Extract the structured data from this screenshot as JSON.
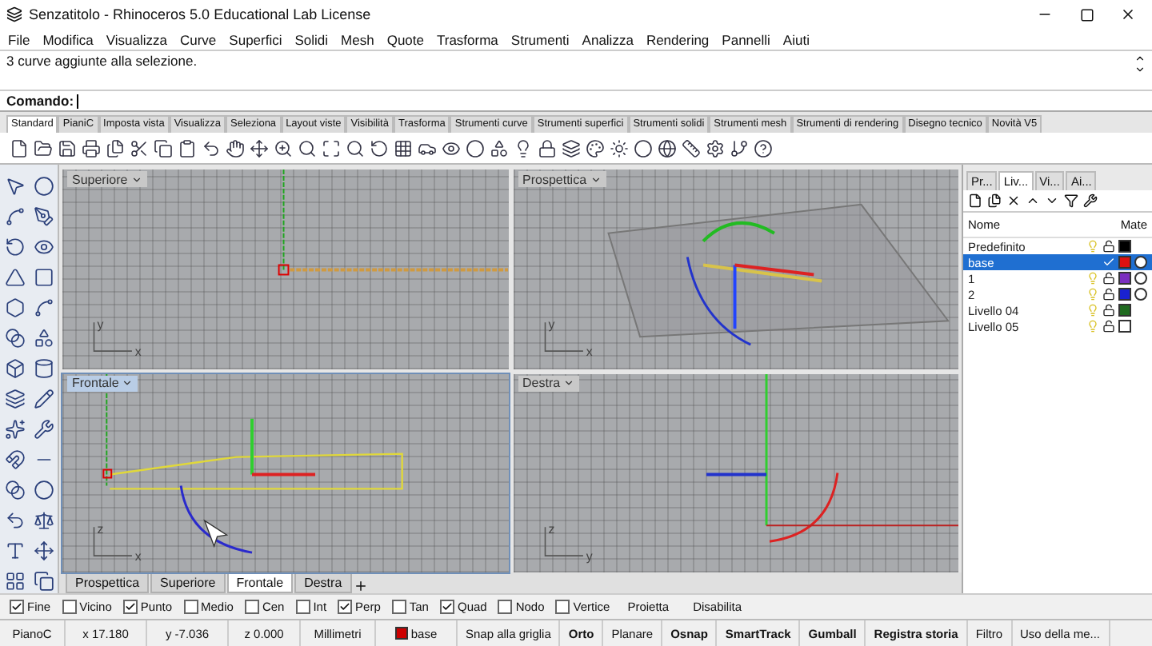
{
  "window": {
    "title": "Senzatitolo - Rhinoceros 5.0 Educational Lab License"
  },
  "menu": [
    "File",
    "Modifica",
    "Visualizza",
    "Curve",
    "Superfici",
    "Solidi",
    "Mesh",
    "Quote",
    "Trasforma",
    "Strumenti",
    "Analizza",
    "Rendering",
    "Pannelli",
    "Aiuti"
  ],
  "command_history": "3 curve aggiunte alla selezione.",
  "command_prompt": "Comando:",
  "toolbar_tabs": [
    {
      "label": "Standard",
      "selected": true
    },
    {
      "label": "PianiC",
      "selected": false
    },
    {
      "label": "Imposta vista",
      "selected": false
    },
    {
      "label": "Visualizza",
      "selected": false
    },
    {
      "label": "Seleziona",
      "selected": false
    },
    {
      "label": "Layout viste",
      "selected": false
    },
    {
      "label": "Visibilità",
      "selected": false
    },
    {
      "label": "Trasforma",
      "selected": false
    },
    {
      "label": "Strumenti curve",
      "selected": false
    },
    {
      "label": "Strumenti superfici",
      "selected": false
    },
    {
      "label": "Strumenti solidi",
      "selected": false
    },
    {
      "label": "Strumenti mesh",
      "selected": false
    },
    {
      "label": "Strumenti di rendering",
      "selected": false
    },
    {
      "label": "Disegno tecnico",
      "selected": false
    },
    {
      "label": "Novità V5",
      "selected": false
    }
  ],
  "viewports": [
    {
      "label": "Superiore",
      "kind": "top",
      "selected": false,
      "axes": [
        "y",
        "x"
      ]
    },
    {
      "label": "Prospettica",
      "kind": "perspective",
      "selected": false,
      "axes": [
        "y",
        "x"
      ]
    },
    {
      "label": "Frontale",
      "kind": "front",
      "selected": true,
      "axes": [
        "z",
        "x"
      ]
    },
    {
      "label": "Destra",
      "kind": "right",
      "selected": false,
      "axes": [
        "z",
        "y"
      ]
    }
  ],
  "viewport_tabs": [
    {
      "label": "Prospettica",
      "selected": false
    },
    {
      "label": "Superiore",
      "selected": false
    },
    {
      "label": "Frontale",
      "selected": true
    },
    {
      "label": "Destra",
      "selected": false
    }
  ],
  "panel": {
    "tabs": [
      {
        "label": "Pr...",
        "selected": false
      },
      {
        "label": "Liv...",
        "selected": true
      },
      {
        "label": "Vi...",
        "selected": false
      },
      {
        "label": "Ai...",
        "selected": false
      }
    ],
    "columns": [
      "Nome",
      "Mate"
    ],
    "layers": [
      {
        "name": "Predefinito",
        "selected": false,
        "current": false,
        "color": "#000000",
        "material": false
      },
      {
        "name": "base",
        "selected": true,
        "current": true,
        "color": "#dd1111",
        "material": true
      },
      {
        "name": "1",
        "selected": false,
        "current": false,
        "color": "#7a2fc0",
        "material": true
      },
      {
        "name": "2",
        "selected": false,
        "current": false,
        "color": "#1a22d0",
        "material": true
      },
      {
        "name": "Livello 04",
        "selected": false,
        "current": false,
        "color": "#1f6a1f",
        "material": false
      },
      {
        "name": "Livello 05",
        "selected": false,
        "current": false,
        "color": "#ffffff",
        "material": false
      }
    ]
  },
  "osnaps": [
    {
      "label": "Fine",
      "checked": true
    },
    {
      "label": "Vicino",
      "checked": false
    },
    {
      "label": "Punto",
      "checked": true
    },
    {
      "label": "Medio",
      "checked": false
    },
    {
      "label": "Cen",
      "checked": false
    },
    {
      "label": "Int",
      "checked": false
    },
    {
      "label": "Perp",
      "checked": true
    },
    {
      "label": "Tan",
      "checked": false
    },
    {
      "label": "Quad",
      "checked": true
    },
    {
      "label": "Nodo",
      "checked": false
    },
    {
      "label": "Vertice",
      "checked": false
    }
  ],
  "osnap_buttons": [
    "Proietta",
    "Disabilita"
  ],
  "status_bar": {
    "plane": "PianoC",
    "x": "x 17.180",
    "y": "y -7.036",
    "z": "z 0.000",
    "units": "Millimetri",
    "layer": {
      "name": "base",
      "color": "#cc0000"
    },
    "toggles": [
      {
        "label": "Snap alla griglia",
        "on": false
      },
      {
        "label": "Orto",
        "on": true
      },
      {
        "label": "Planare",
        "on": false
      },
      {
        "label": "Osnap",
        "on": true
      },
      {
        "label": "SmartTrack",
        "on": true
      },
      {
        "label": "Gumball",
        "on": true
      },
      {
        "label": "Registra storia",
        "on": true
      },
      {
        "label": "Filtro",
        "on": false
      },
      {
        "label": "Uso della me...",
        "on": false
      }
    ]
  }
}
